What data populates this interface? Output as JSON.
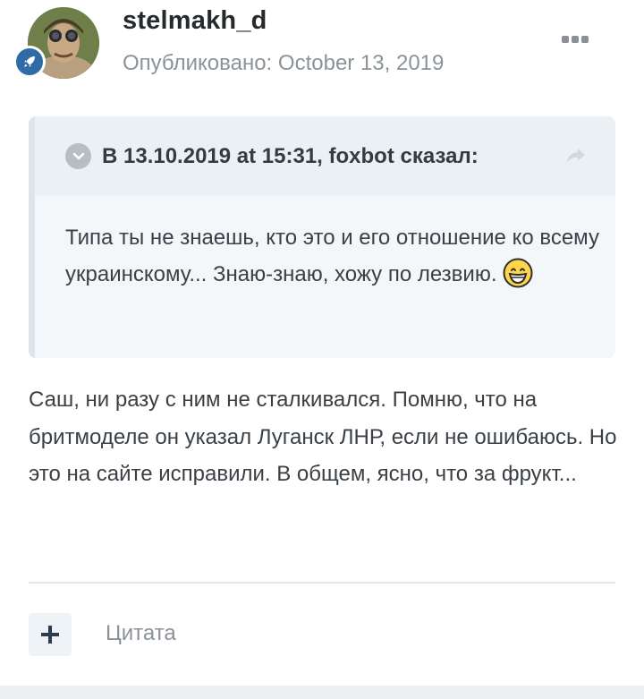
{
  "post": {
    "username": "stelmakh_d",
    "published_label": "Опубликовано:",
    "published_date": "October 13, 2019",
    "badge_icon": "rocket-icon",
    "menu_icon": "more-dots-icon"
  },
  "quote": {
    "title": "В 13.10.2019 at 15:31, foxbot сказал:",
    "text": "Типа ты не знаешь, кто это и его отношение ко всему украинскому... Знаю-знаю, хожу по лезвию.",
    "emoji": "grinning-smiley-icon"
  },
  "body": {
    "text": "Саш, ни разу с ним не сталкивался. Помню, что на бритмоделе он указал Луганск ЛНР, если не ошибаюсь. Но это на сайте исправили. В общем, ясно, что за фрукт..."
  },
  "actions": {
    "quote_label": "Цитата"
  },
  "colors": {
    "badge": "#2f6ba7",
    "quote_bg": "#f3f7fa",
    "quote_head_bg": "#ebf0f4"
  }
}
